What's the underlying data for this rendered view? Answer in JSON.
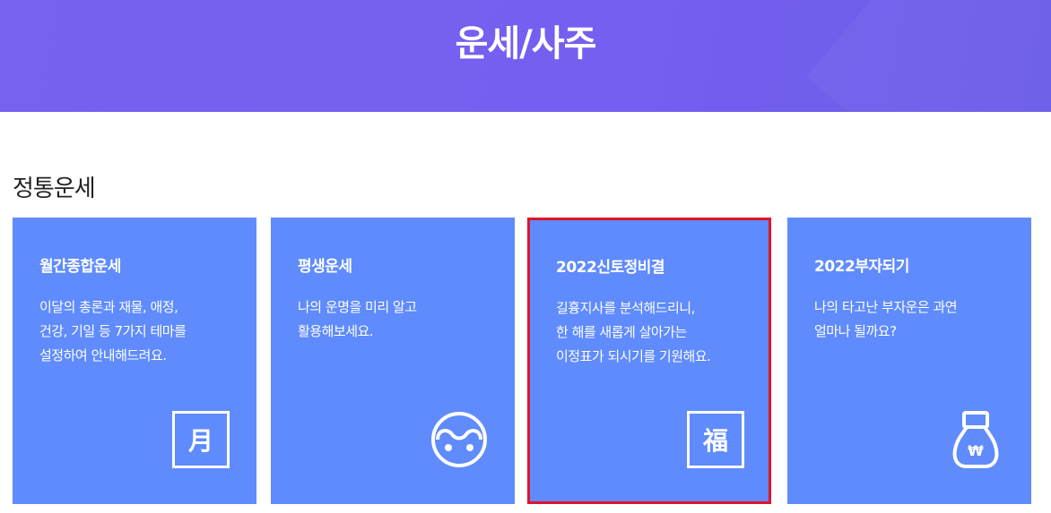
{
  "banner": {
    "title": "운세/사주"
  },
  "section": {
    "title": "정통운세"
  },
  "cards": [
    {
      "title": "월간종합운세",
      "desc": [
        "이달의 총론과 재물, 애정,",
        "건강, 기일 등 7가지 테마를",
        "설정하여 안내해드려요."
      ],
      "icon_name": "moon-character-icon",
      "icon_glyph": "月"
    },
    {
      "title": "평생운세",
      "desc": [
        "나의 운명을 미리 알고",
        "활용해보세요."
      ],
      "icon_name": "yin-yang-icon"
    },
    {
      "title": "2022신토정비결",
      "desc": [
        "길흉지사를 분석해드리니,",
        "한 해를 새롭게 살아가는",
        "이정표가 되시기를 기원해요."
      ],
      "icon_name": "fortune-character-icon",
      "icon_glyph": "福"
    },
    {
      "title": "2022부자되기",
      "desc": [
        "나의 타고난 부자운은 과연",
        "얼마나 될까요?"
      ],
      "icon_name": "money-bag-icon",
      "icon_glyph": "₩"
    }
  ],
  "colors": {
    "banner": "#745ff0",
    "card": "#5f8bfd",
    "selected_border": "#e0142b"
  }
}
